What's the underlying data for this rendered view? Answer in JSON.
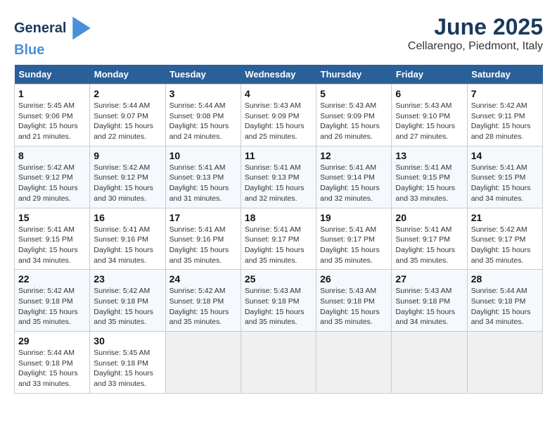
{
  "header": {
    "logo_line1": "General",
    "logo_line2": "Blue",
    "title": "June 2025",
    "subtitle": "Cellarengo, Piedmont, Italy"
  },
  "weekdays": [
    "Sunday",
    "Monday",
    "Tuesday",
    "Wednesday",
    "Thursday",
    "Friday",
    "Saturday"
  ],
  "weeks": [
    [
      {
        "day": "1",
        "sunrise": "5:45 AM",
        "sunset": "9:06 PM",
        "daylight": "15 hours and 21 minutes."
      },
      {
        "day": "2",
        "sunrise": "5:44 AM",
        "sunset": "9:07 PM",
        "daylight": "15 hours and 22 minutes."
      },
      {
        "day": "3",
        "sunrise": "5:44 AM",
        "sunset": "9:08 PM",
        "daylight": "15 hours and 24 minutes."
      },
      {
        "day": "4",
        "sunrise": "5:43 AM",
        "sunset": "9:09 PM",
        "daylight": "15 hours and 25 minutes."
      },
      {
        "day": "5",
        "sunrise": "5:43 AM",
        "sunset": "9:09 PM",
        "daylight": "15 hours and 26 minutes."
      },
      {
        "day": "6",
        "sunrise": "5:43 AM",
        "sunset": "9:10 PM",
        "daylight": "15 hours and 27 minutes."
      },
      {
        "day": "7",
        "sunrise": "5:42 AM",
        "sunset": "9:11 PM",
        "daylight": "15 hours and 28 minutes."
      }
    ],
    [
      {
        "day": "8",
        "sunrise": "5:42 AM",
        "sunset": "9:12 PM",
        "daylight": "15 hours and 29 minutes."
      },
      {
        "day": "9",
        "sunrise": "5:42 AM",
        "sunset": "9:12 PM",
        "daylight": "15 hours and 30 minutes."
      },
      {
        "day": "10",
        "sunrise": "5:41 AM",
        "sunset": "9:13 PM",
        "daylight": "15 hours and 31 minutes."
      },
      {
        "day": "11",
        "sunrise": "5:41 AM",
        "sunset": "9:13 PM",
        "daylight": "15 hours and 32 minutes."
      },
      {
        "day": "12",
        "sunrise": "5:41 AM",
        "sunset": "9:14 PM",
        "daylight": "15 hours and 32 minutes."
      },
      {
        "day": "13",
        "sunrise": "5:41 AM",
        "sunset": "9:15 PM",
        "daylight": "15 hours and 33 minutes."
      },
      {
        "day": "14",
        "sunrise": "5:41 AM",
        "sunset": "9:15 PM",
        "daylight": "15 hours and 34 minutes."
      }
    ],
    [
      {
        "day": "15",
        "sunrise": "5:41 AM",
        "sunset": "9:15 PM",
        "daylight": "15 hours and 34 minutes."
      },
      {
        "day": "16",
        "sunrise": "5:41 AM",
        "sunset": "9:16 PM",
        "daylight": "15 hours and 34 minutes."
      },
      {
        "day": "17",
        "sunrise": "5:41 AM",
        "sunset": "9:16 PM",
        "daylight": "15 hours and 35 minutes."
      },
      {
        "day": "18",
        "sunrise": "5:41 AM",
        "sunset": "9:17 PM",
        "daylight": "15 hours and 35 minutes."
      },
      {
        "day": "19",
        "sunrise": "5:41 AM",
        "sunset": "9:17 PM",
        "daylight": "15 hours and 35 minutes."
      },
      {
        "day": "20",
        "sunrise": "5:41 AM",
        "sunset": "9:17 PM",
        "daylight": "15 hours and 35 minutes."
      },
      {
        "day": "21",
        "sunrise": "5:42 AM",
        "sunset": "9:17 PM",
        "daylight": "15 hours and 35 minutes."
      }
    ],
    [
      {
        "day": "22",
        "sunrise": "5:42 AM",
        "sunset": "9:18 PM",
        "daylight": "15 hours and 35 minutes."
      },
      {
        "day": "23",
        "sunrise": "5:42 AM",
        "sunset": "9:18 PM",
        "daylight": "15 hours and 35 minutes."
      },
      {
        "day": "24",
        "sunrise": "5:42 AM",
        "sunset": "9:18 PM",
        "daylight": "15 hours and 35 minutes."
      },
      {
        "day": "25",
        "sunrise": "5:43 AM",
        "sunset": "9:18 PM",
        "daylight": "15 hours and 35 minutes."
      },
      {
        "day": "26",
        "sunrise": "5:43 AM",
        "sunset": "9:18 PM",
        "daylight": "15 hours and 35 minutes."
      },
      {
        "day": "27",
        "sunrise": "5:43 AM",
        "sunset": "9:18 PM",
        "daylight": "15 hours and 34 minutes."
      },
      {
        "day": "28",
        "sunrise": "5:44 AM",
        "sunset": "9:18 PM",
        "daylight": "15 hours and 34 minutes."
      }
    ],
    [
      {
        "day": "29",
        "sunrise": "5:44 AM",
        "sunset": "9:18 PM",
        "daylight": "15 hours and 33 minutes."
      },
      {
        "day": "30",
        "sunrise": "5:45 AM",
        "sunset": "9:18 PM",
        "daylight": "15 hours and 33 minutes."
      },
      null,
      null,
      null,
      null,
      null
    ]
  ]
}
